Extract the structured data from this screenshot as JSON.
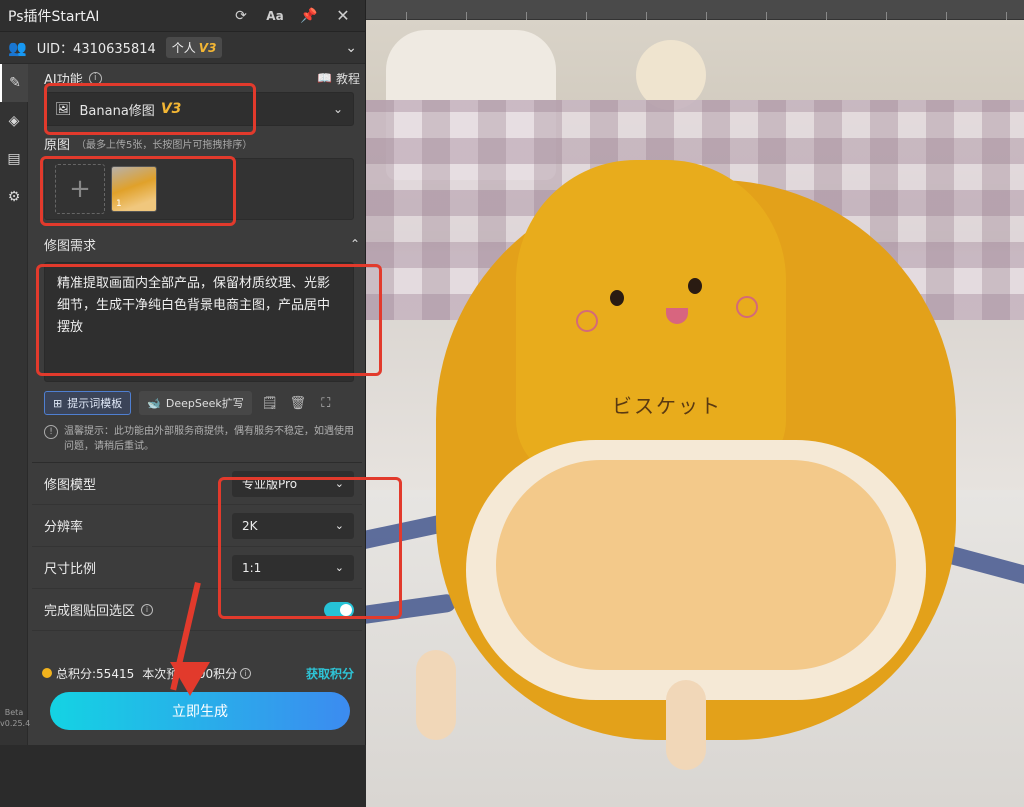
{
  "titlebar": {
    "title": "Ps插件StartAI",
    "icons": [
      "refresh-icon",
      "font-size-icon",
      "pin-icon",
      "close-icon"
    ]
  },
  "user": {
    "uid": "UID：4310635814",
    "tier": "个人",
    "version": "V3"
  },
  "sidebar": {
    "items": [
      "brush-icon",
      "layers-icon",
      "save-icon",
      "gear-icon"
    ],
    "beta_label": "Beta",
    "version": "v0.25.4"
  },
  "ai_function": {
    "label": "AI功能",
    "tutorial": "教程",
    "selected": "Banana修图",
    "selected_version": "V3"
  },
  "images": {
    "label": "原图",
    "hint": "（最多上传5张，长按图片可拖拽排序）",
    "thumb_index": "1"
  },
  "requirement": {
    "label": "修图需求",
    "text": "精准提取画面内全部产品，保留材质纹理、光影细节，生成干净纯白色背景电商主图，产品居中摆放",
    "template_button": "提示词模板",
    "deepseek_button": "DeepSeek扩写",
    "notice": "温馨提示：此功能由外部服务商提供，偶有服务不稳定，如遇使用问题，请稍后重试。"
  },
  "options": {
    "model_label": "修图模型",
    "model_value": "专业版Pro",
    "resolution_label": "分辨率",
    "resolution_value": "2K",
    "ratio_label": "尺寸比例",
    "ratio_value": "1:1",
    "paste_back_label": "完成图贴回选区",
    "paste_back_on": true
  },
  "points": {
    "total": "总积分:55415",
    "this_time": "本次预计200积分",
    "get_points": "获取积分"
  },
  "generate_button": "立即生成",
  "canvas": {
    "sign_text": "ビスケット"
  },
  "colors": {
    "accent": "#26c2d6",
    "v3": "#f3b634",
    "annotation": "#e23a2c",
    "button_start": "#14d3e3",
    "button_end": "#3c8bf0"
  }
}
